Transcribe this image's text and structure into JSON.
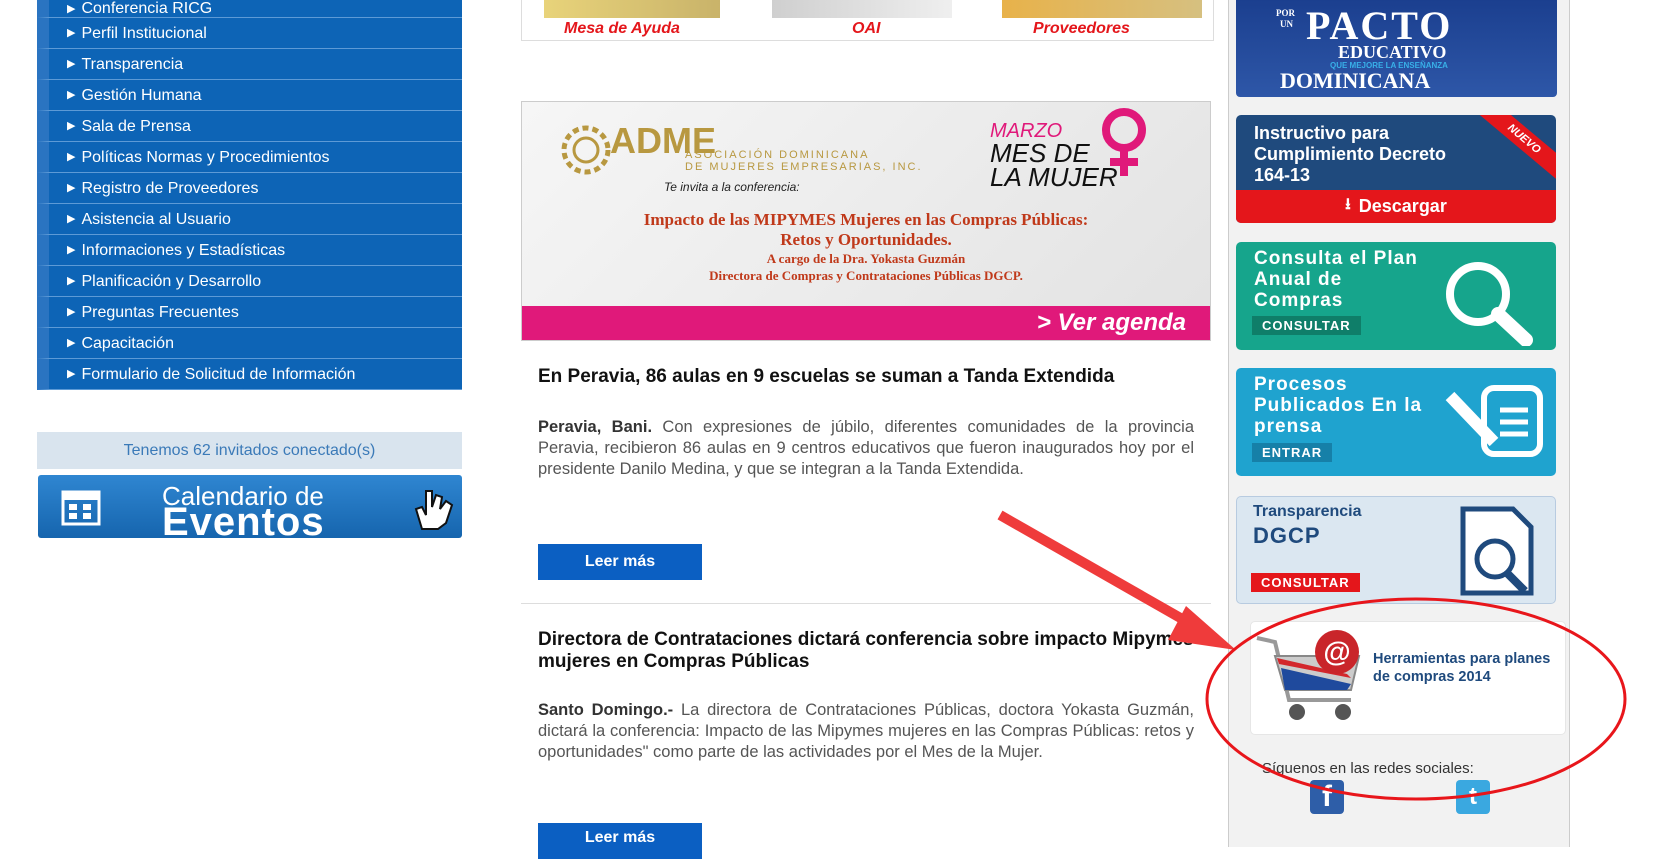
{
  "menu": {
    "items": [
      "Conferencia RICG",
      "Perfil Institucional",
      "Transparencia",
      "Gestión Humana",
      "Sala de Prensa",
      "Políticas Normas y Procedimientos",
      "Registro de Proveedores",
      "Asistencia al Usuario",
      "Informaciones y Estadísticas",
      "Planificación y Desarrollo",
      "Preguntas Frecuentes",
      "Capacitación",
      "Formulario de Solicitud de Información"
    ],
    "online_text": "Tenemos 62 invitados conectado(s)",
    "calendar_line1": "Calendario de",
    "calendar_line2": "Eventos"
  },
  "top_links": [
    "Mesa de Ayuda",
    "OAI",
    "Proveedores"
  ],
  "banner": {
    "org": "ADME",
    "org_line1": "ASOCIACIÓN DOMINICANA",
    "org_line2": "DE MUJERES EMPRESARIAS, INC.",
    "invite": "Te invita a la conferencia:",
    "month": "MARZO",
    "mes_line1": "MES DE",
    "mes_line2": "LA MUJER",
    "title1": "Impacto de las MIPYMES Mujeres en las Compras Públicas:",
    "title2": "Retos y Oportunidades.",
    "speaker1": "A cargo de la Dra. Yokasta Guzmán",
    "speaker2": "Directora de Compras y Contrataciones Públicas DGCP.",
    "cta": "> Ver agenda"
  },
  "news": [
    {
      "title": "En Peravia, 86 aulas en 9 escuelas se suman a Tanda Extendida",
      "lead": "Peravia, Bani.",
      "body": " Con expresiones de júbilo, diferentes comunidades de la provincia Peravia, recibieron 86 aulas en 9 centros educativos que fueron inaugurados hoy por el presidente Danilo Medina, y que se integran a la Tanda Extendida.",
      "button": "Leer más"
    },
    {
      "title": "Directora de Contrataciones dictará conferencia sobre impacto Mipymes mujeres en Compras Públicas",
      "lead": "Santo Domingo.-",
      "body": " La directora de Contrataciones Públicas, doctora Yokasta Guzmán, dictará la conferencia: Impacto de las Mipymes mujeres en las Compras Públicas: retos y oportunidades\" como parte de las actividades por el Mes de la Mujer.",
      "button": "Leer más"
    }
  ],
  "right": {
    "pacto_por": "POR",
    "pacto_un": "UN",
    "pacto_word": "PACTO",
    "pacto_line2": "EDUCATIVO",
    "pacto_line3": "QUE MEJORE LA ENSEÑANZA",
    "pacto_line4": "DOMINICANA",
    "instructivo_title": "Instructivo para Cumplimiento Decreto 164-13",
    "instructivo_badge": "NUEVO",
    "instructivo_button": "Descargar",
    "plan_title": "Consulta el Plan Anual de Compras",
    "plan_tag": "CONSULTAR",
    "procesos_title": "Procesos Publicados En la prensa",
    "procesos_tag": "ENTRAR",
    "transp_line1": "Transparencia",
    "transp_line2": "DGCP",
    "transp_tag": "CONSULTAR",
    "herr_title": "Herramientas para planes de compras 2014",
    "social_label": "Síguenos en las redes sociales:",
    "colors": {
      "teal": "#16a58c",
      "blue": "#1fa3cf",
      "navy": "#1f4a7d",
      "red": "#e4161b",
      "menu": "#0d64b6"
    }
  }
}
